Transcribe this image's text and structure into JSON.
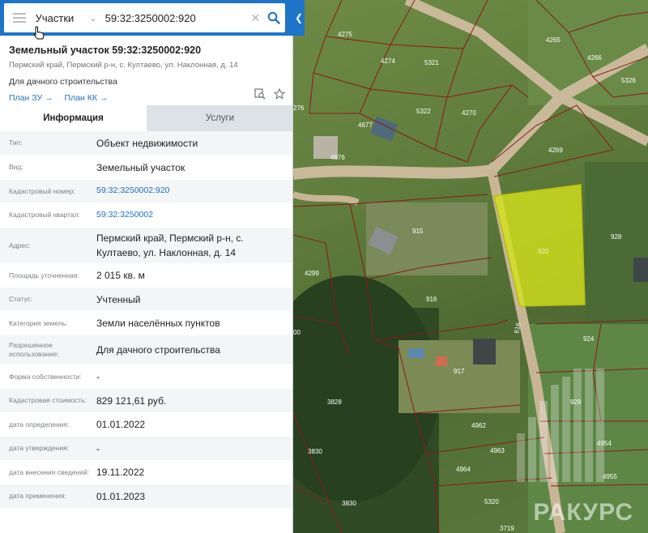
{
  "search": {
    "type_label": "Участки",
    "query": "59:32:3250002:920"
  },
  "parcel": {
    "title": "Земельный участок 59:32:3250002:920",
    "address": "Пермский край, Пермский р-н, с. Култаево, ул. Наклонная, д. 14",
    "usage": "Для дачного строительства",
    "links": [
      "План ЗУ →",
      "План КК →"
    ]
  },
  "tabs": [
    "Информация",
    "Услуги"
  ],
  "rows": [
    {
      "label": "Тип:",
      "value": "Объект недвижимости",
      "link": false
    },
    {
      "label": "Вид:",
      "value": "Земельный участок",
      "link": false
    },
    {
      "label": "Кадастровый номер:",
      "value": "59:32:3250002:920",
      "link": true
    },
    {
      "label": "Кадастровый квартал:",
      "value": "59:32:3250002",
      "link": true
    },
    {
      "label": "Адрес:",
      "value": "Пермский край, Пермский р-н, с. Култаево, ул. Наклонная, д. 14",
      "link": false
    },
    {
      "label": "Площадь уточненная:",
      "value": "2 015 кв. м",
      "link": false
    },
    {
      "label": "Статус:",
      "value": "Учтенный",
      "link": false
    },
    {
      "label": "Категория земель:",
      "value": "Земли населённых пунктов",
      "link": false
    },
    {
      "label": "Разрешенное использование:",
      "value": "Для дачного строительства",
      "link": false
    },
    {
      "label": "Форма собственности:",
      "value": "-",
      "link": false
    },
    {
      "label": "Кадастровая стоимость:",
      "value": "829 121,61 руб.",
      "link": false
    },
    {
      "label": "дата определения:",
      "value": "01.01.2022",
      "link": false
    },
    {
      "label": "дата утверждения:",
      "value": "-",
      "link": false
    },
    {
      "label": "дата внесения сведений:",
      "value": "19.11.2022",
      "link": false
    },
    {
      "label": "дата применения:",
      "value": "01.01.2023",
      "link": false
    }
  ],
  "map": {
    "parcel_labels": [
      "4265",
      "4275",
      "4274",
      "5321",
      "4266",
      "5326",
      "276",
      "5322",
      "4270",
      "4677",
      "4676",
      "4269",
      "915",
      "920",
      "928",
      "4299",
      "916",
      "924",
      "00",
      "917",
      "616",
      "3828",
      "929",
      "4962",
      "4954",
      "3830",
      "4963",
      "4955",
      "4964",
      "3830",
      "3719",
      "5320"
    ],
    "selected_parcel": "920",
    "selected_color": "#d6e21b",
    "boundary_color": "#8b1a1a"
  },
  "watermark": "РАКУРС",
  "colors": {
    "accent": "#1e74c9",
    "link": "#1f6fbf"
  }
}
